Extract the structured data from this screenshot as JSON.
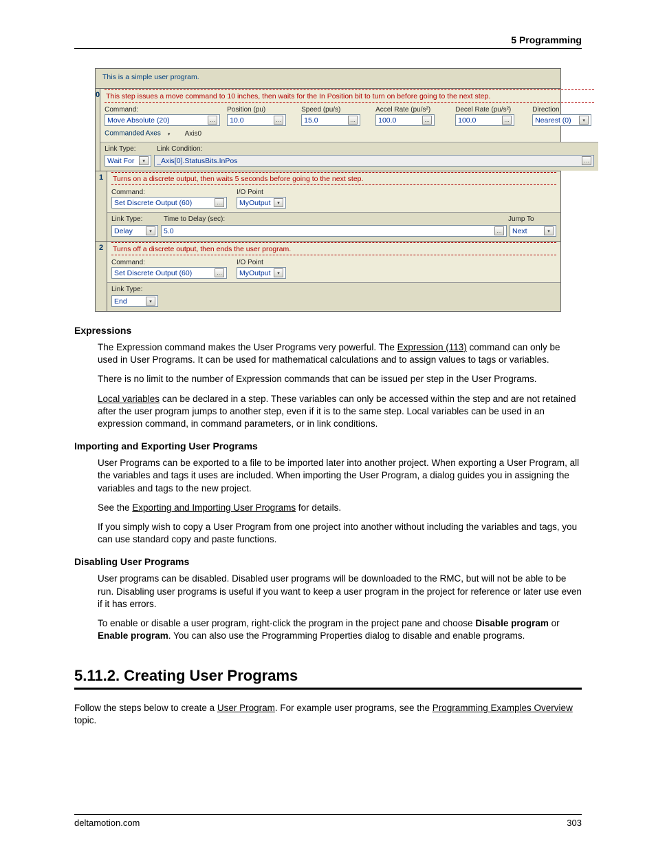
{
  "header": {
    "section": "5  Programming"
  },
  "screenshot": {
    "title": "This is a simple user program.",
    "steps": [
      {
        "num": "0",
        "desc": "This step issues a move command to 10 inches, then waits for the In Position bit to turn on before going to the next step.",
        "cmd_label": "Command:",
        "cmd_value": "Move Absolute (20)",
        "params": [
          {
            "label": "Position (pu)",
            "value": "10.0"
          },
          {
            "label": "Speed (pu/s)",
            "value": "15.0"
          },
          {
            "label": "Accel Rate (pu/s²)",
            "value": "100.0"
          },
          {
            "label": "Decel Rate (pu/s²)",
            "value": "100.0"
          },
          {
            "label": "Direction",
            "value": "Nearest (0)"
          }
        ],
        "axes_label": "Commanded Axes",
        "axes_value": "Axis0",
        "link_type_label": "Link Type:",
        "link_type_value": "Wait For",
        "link_cond_label": "Link Condition:",
        "link_cond_value": "_Axis[0].StatusBits.InPos"
      },
      {
        "num": "1",
        "desc": "Turns on a discrete output, then waits 5 seconds before going to the next step.",
        "cmd_label": "Command:",
        "cmd_value": "Set Discrete Output (60)",
        "io_label": "I/O Point",
        "io_value": "MyOutput",
        "link_type_label": "Link Type:",
        "link_type_value": "Delay",
        "delay_label": "Time to Delay (sec):",
        "delay_value": "5.0",
        "jump_label": "Jump To",
        "jump_value": "Next"
      },
      {
        "num": "2",
        "desc": "Turns off a discrete output, then ends the user program.",
        "cmd_label": "Command:",
        "cmd_value": "Set Discrete Output (60)",
        "io_label": "I/O Point",
        "io_value": "MyOutput",
        "link_type_label": "Link Type:",
        "link_type_value": "End"
      }
    ]
  },
  "sections": {
    "expr_h": "Expressions",
    "expr_p1a": "The Expression command makes the User Programs very powerful. The ",
    "expr_link1": "Expression (113)",
    "expr_p1b": " command can only be used in User Programs. It can be used for mathematical calculations and to assign values to tags or variables.",
    "expr_p2": "There is no limit to the number of Expression commands that can be issued per step in the User Programs.",
    "expr_p3a": "",
    "expr_link2": "Local variables",
    "expr_p3b": " can be declared in a step. These variables can only be accessed within the step and are not retained after the user program jumps to another step, even if it is to the same step. Local variables can be used in an expression command, in command parameters, or in link conditions.",
    "import_h": "Importing and Exporting User Programs",
    "import_p1": "User Programs can be exported to a file to be imported later into another project. When exporting a User Program, all the variables and tags it uses are included. When importing the User Program, a dialog guides you in assigning the variables and tags to the new project.",
    "import_p2a": "See the ",
    "import_link": "Exporting and Importing User Programs",
    "import_p2b": " for details.",
    "import_p3": "If you simply wish to copy a User Program from one project into another without including the variables and tags, you can use standard copy and paste functions.",
    "disable_h": "Disabling User Programs",
    "disable_p1": "User programs can be disabled. Disabled user programs will be downloaded to the RMC, but will not be able to be run. Disabling user programs is useful if you want to keep a user program in the project for reference or later use even if it has errors.",
    "disable_p2a": "To enable or disable a user program, right-click the program in the project pane and choose ",
    "disable_b1": "Disable program",
    "disable_p2b": " or ",
    "disable_b2": "Enable program",
    "disable_p2c": ". You can also use the Programming Properties dialog to disable and enable programs.",
    "h2": "5.11.2. Creating User Programs",
    "create_p1a": "Follow the steps below to create a ",
    "create_link1": "User Program",
    "create_p1b": ". For example user programs, see the ",
    "create_link2": "Programming Examples Overview",
    "create_p1c": " topic."
  },
  "footer": {
    "site": "deltamotion.com",
    "page": "303"
  }
}
